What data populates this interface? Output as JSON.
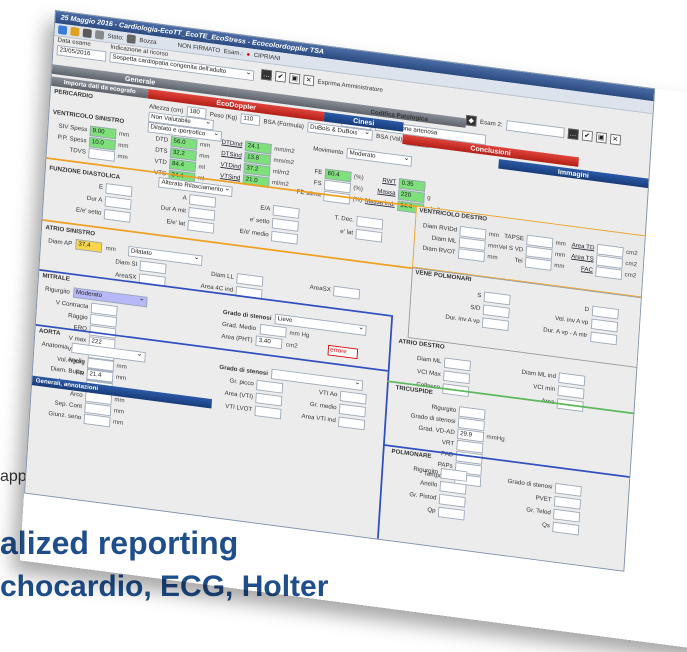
{
  "background": {
    "subtitle_tail": "application.",
    "headline_line1": "alized reporting",
    "headline_line2": "chocardio, ECG, Holter"
  },
  "window": {
    "title": "25 Maggio 2016 - Cardiologia-EcoTT_EcoTE_EcoStress - Ecocolordoppler TSA",
    "toolbar": {
      "stato_label": "Stato:",
      "stato_value": "Bozza",
      "non_firmato": "NON FIRMATO",
      "esam_label": "Esam.:",
      "esam_value": "CIPRIANI",
      "esprima": "Esprima Amministratore"
    },
    "data_esame_label": "Data esame",
    "data_esame": "23/05/2016",
    "indicazione_label": "Indicazione al ricorso",
    "indicazione": "Sospetta cardiopatia congenita dell'adulto",
    "esam2_label": "Esam 2:",
    "codifica_label": "Codifica Patologica",
    "codifica_value": "Ipertensione arteriosa",
    "tabs": {
      "generale": "Generale",
      "ecodoppler": "EcoDoppler",
      "cinesi": "Cinesi",
      "conclusioni": "Conclusioni",
      "immagini": "Immagini"
    },
    "importa": "Importa dati da ecografo",
    "altezza_label": "Altezza (cm)",
    "altezza": "180",
    "peso_label": "Peso (Kg)",
    "peso": "110",
    "bsa_label": "BSA (Formula)",
    "bsa_formula": "DuBois & DuBois",
    "bsa_val_label": "BSA (Val)",
    "bsa_val": "2.33",
    "pericardio": "PERICARDIO",
    "pericardio_val": "Non Valutabile",
    "ventricolo_sx": "VENTRICOLO SINISTRO",
    "vs_rows": [
      {
        "label": "SIV Spess",
        "val": "9.00",
        "unit": "mm"
      },
      {
        "label": "P.P. Spess",
        "val": "10.0",
        "unit": "mm"
      },
      {
        "label": "TDVS",
        "val": "",
        "unit": "mm"
      }
    ],
    "dilatato": "Dilatato e ipertrofico",
    "vs_mid": [
      {
        "label": "DTD",
        "val": "56.0",
        "unit": "mm"
      },
      {
        "label": "DTS",
        "val": "32.2",
        "unit": "mm"
      },
      {
        "label": "VTD",
        "val": "84.4",
        "unit": "ml"
      },
      {
        "label": "VTS",
        "val": "34.4",
        "unit": "ml"
      }
    ],
    "vs_idx": [
      {
        "label": "DTDind",
        "val": "24.1",
        "unit": "mm/m2"
      },
      {
        "label": "DTSind",
        "val": "13.8",
        "unit": "mm/m2"
      },
      {
        "label": "VTDind",
        "val": "37.2",
        "unit": "ml/m2"
      },
      {
        "label": "VTSind",
        "val": "21.0",
        "unit": "ml/m2"
      }
    ],
    "movimento_label": "Movimento",
    "movimento": "Moderato",
    "fe_rows": [
      {
        "label": "FE",
        "val": "60.4",
        "unit": "(%)"
      },
      {
        "label": "FS",
        "val": "",
        "unit": "(%)"
      },
      {
        "label": "FE stima",
        "val": "",
        "unit": "(%)"
      }
    ],
    "rwt_rows": [
      {
        "label": "RWT",
        "val": "0.35",
        "unit": ""
      },
      {
        "label": "Massa",
        "val": "220",
        "unit": "g"
      },
      {
        "label": "Massa ind.",
        "val": "94.4",
        "unit": "g/m2"
      }
    ],
    "funzione_diastolica": "FUNZIONE DIASTOLICA",
    "alterato": "Alterato Rilasciamento",
    "diast": [
      "E",
      "A",
      "E/A",
      "T. Dec.",
      "Dur A",
      "Dur A mit",
      "e' setto",
      "e' lat",
      "E/e' setto",
      "E/e' lat",
      "E/e' medio"
    ],
    "ventricolo_dx": "VENTRICOLO DESTRO",
    "vd_left": [
      "Diam RVIDd",
      "Diam ML",
      "Diam RVOT"
    ],
    "vd_mid": [
      "TAPSE",
      "Vel S VD",
      "Tei"
    ],
    "vd_right": [
      "Area TD",
      "Area TS",
      "FAC"
    ],
    "vene_polmonari": "VENE POLMONARI",
    "vp": [
      "S",
      "D",
      "S/D",
      "Vel. inv A vp",
      "Dur. inv A vp",
      "Dur. A vp - A mtr"
    ],
    "atrio_sx": "ATRIO SINISTRO",
    "atrio_sx_diam": "Diam AP",
    "atrio_sx_val": "37.4",
    "dilatato2": "Dilatato",
    "atrio_sx_fields": [
      "Diam SI",
      "Diam LL",
      "AreaSX",
      "AreaSX",
      "Area 4C ind"
    ],
    "mitrale": "MITRALE",
    "rigurgito": "Rigurgito",
    "rigurgito_val": "Moderato",
    "mitrale_fields": [
      "V Contracta",
      "Raggio",
      "ERO",
      "V max",
      "VTI rig",
      "Vol. rigurg",
      "FR"
    ],
    "mitrale_vals": {
      "vmax": "222",
      "vti": "29.4"
    },
    "grado_stenosi": "Grado di stenosi",
    "grado_val": "Lieve",
    "grad_medio": "Grad. Medio",
    "area_pht": "Area (PHT)",
    "area_pht_val": "3.40",
    "errore": "errore",
    "aorta": "AORTA",
    "anatomia": "Anatomia",
    "aorta_fields": [
      "Anello",
      "Diam. Bulbo",
      "Aorta asc",
      "Arco",
      "Sep. Cont",
      "Giunz. seno"
    ],
    "aorta_bulbo": "21.4",
    "grado_stenosi2": "Grado di stenosi",
    "ao_sten": [
      "Gr. picco",
      "VTI Ao",
      "Area (VTI)",
      "Gr. medio",
      "VTI LVOT",
      "Area VTI ind"
    ],
    "atrio_dx": "ATRIO DESTRO",
    "adx": [
      "Diam ML",
      "Diam ML ind",
      "VCI Max",
      "VCI min",
      "Collasso",
      "Area"
    ],
    "tricuspide": "TRICUSPIDE",
    "tri": [
      "Rigurgito",
      "Grado di stenosi",
      "Grad. VD-AD",
      "VRT",
      "PAD",
      "PAPs",
      "Tempo AE"
    ],
    "tri_grad": "29.9",
    "polmonare": "POLMONARE",
    "pol": [
      "Rigurgito",
      "Grado di stenosi",
      "Anello",
      "PVET",
      "Gr. Pistod",
      "Gr. Telod",
      "Qp",
      "Qs"
    ],
    "footer_tab": "Generali, annotazioni"
  }
}
